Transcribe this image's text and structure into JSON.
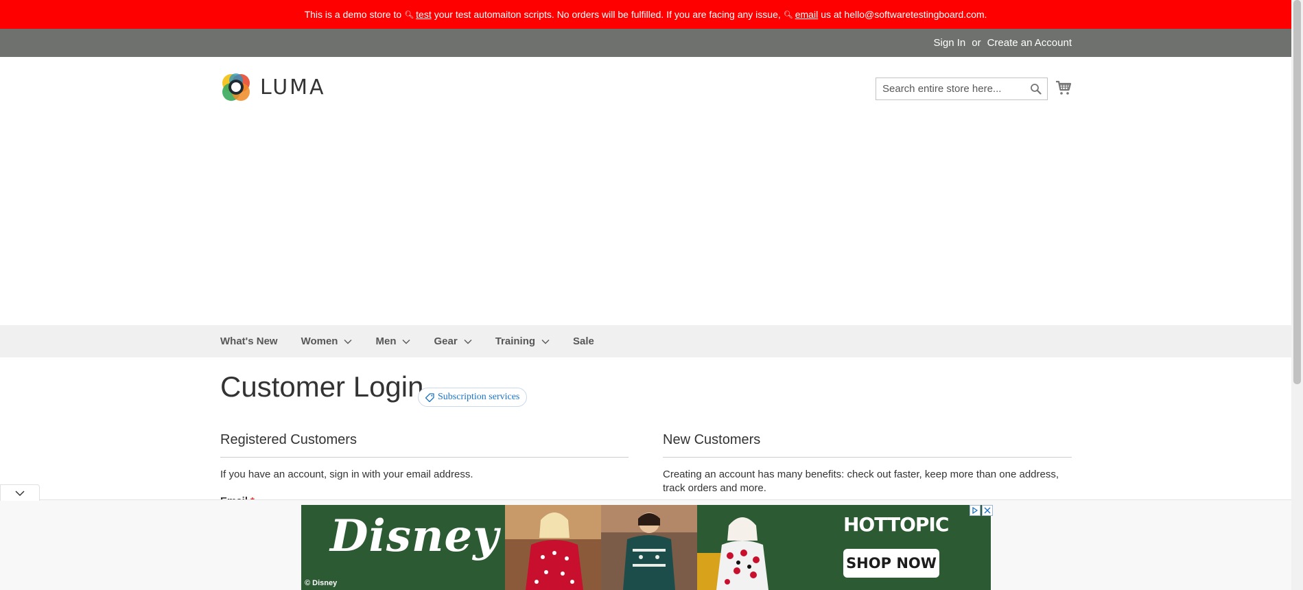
{
  "banner": {
    "part1": "This is a demo store to",
    "link1": "test",
    "part2": "your test automaiton scripts. No orders will be fulfilled. If you are facing any issue,",
    "link2": "email",
    "part3": "us at hello@softwaretestingboard.com."
  },
  "header": {
    "sign_in": "Sign In",
    "or": "or",
    "create_account": "Create an Account",
    "logo_text": "LUMA"
  },
  "search": {
    "placeholder": "Search entire store here..."
  },
  "nav": {
    "items": [
      {
        "label": "What's New",
        "dropdown": false
      },
      {
        "label": "Women",
        "dropdown": true
      },
      {
        "label": "Men",
        "dropdown": true
      },
      {
        "label": "Gear",
        "dropdown": true
      },
      {
        "label": "Training",
        "dropdown": true
      },
      {
        "label": "Sale",
        "dropdown": false
      }
    ]
  },
  "page": {
    "title": "Customer Login",
    "badge": "Subscription services"
  },
  "registered": {
    "title": "Registered Customers",
    "text": "If you have an account, sign in with your email address.",
    "email_label": "Email",
    "required_mark": "*"
  },
  "new_customers": {
    "title": "New Customers",
    "text": "Creating an account has many benefits: check out faster, keep more than one address, track orders and more."
  },
  "ad": {
    "brand": "Disney",
    "copyright": "© Disney",
    "store": "HOTTOPIC",
    "cta": "SHOP NOW"
  },
  "colors": {
    "banner": "#ff0000",
    "header_panel": "#6e716e",
    "nav_bg": "#f0f0f0",
    "ad_green": "#2c5a33"
  }
}
